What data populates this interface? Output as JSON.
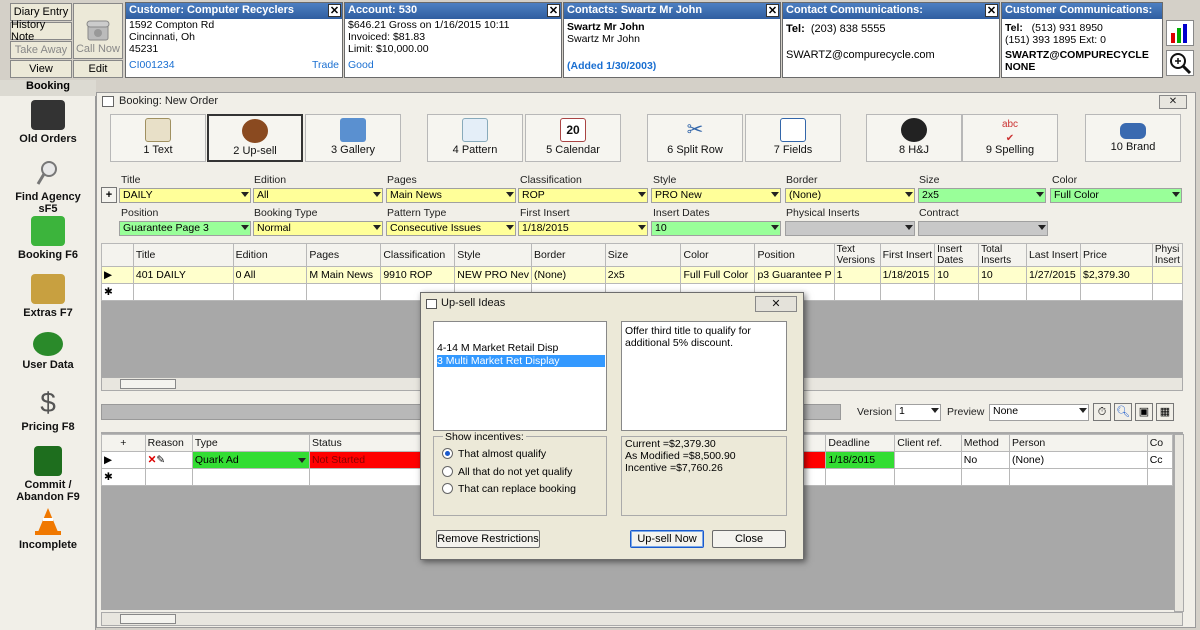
{
  "quick_buttons": {
    "diary": "Diary Entry",
    "history": "History Note",
    "takeaway": "Take Away",
    "view": "View",
    "callnow": "Call Now",
    "edit": "Edit"
  },
  "header": {
    "customer": {
      "title": "Customer: Computer Recyclers",
      "addr1": "1592 Compton Rd",
      "addr2": "Cincinnati, Oh",
      "zip": "45231",
      "id": "CI001234",
      "tag": "Trade"
    },
    "account": {
      "title": "Account: 530",
      "l1": "$646.21 Gross on 1/16/2015 10:11",
      "l2": "Invoiced: $81.83",
      "l3": "Limit: $10,000.00",
      "status": "Good"
    },
    "contacts": {
      "title": "Contacts: Swartz Mr John",
      "name_bold": "Swartz Mr John",
      "name": "Swartz Mr John",
      "added": "(Added 1/30/2003)"
    },
    "contact_comms": {
      "title": "Contact Communications:",
      "tel_label": "Tel:",
      "tel": "(203) 838 5555",
      "email": "SWARTZ@compurecycle.com"
    },
    "customer_comms": {
      "title": "Customer Communications:",
      "tel_label": "Tel:",
      "tel1": "(513) 931 8950",
      "tel2": "(151) 393 1895 Ext: 0",
      "email": "SWARTZ@COMPURECYCLE",
      "none": "NONE"
    }
  },
  "sidebar": {
    "section": "Booking",
    "items": [
      {
        "label": "Old Orders"
      },
      {
        "label": "Find Agency sF5"
      },
      {
        "label": "Booking F6"
      },
      {
        "label": "Extras F7"
      },
      {
        "label": "User Data"
      },
      {
        "label": "Pricing F8"
      },
      {
        "label": "Commit / Abandon F9"
      },
      {
        "label": "Incomplete"
      }
    ]
  },
  "window": {
    "title": "Booking: New Order"
  },
  "toolbar": [
    {
      "label": "1 Text"
    },
    {
      "label": "2 Up-sell"
    },
    {
      "label": "3 Gallery"
    },
    {
      "label": "4 Pattern"
    },
    {
      "label": "5 Calendar"
    },
    {
      "label": "6 Split Row"
    },
    {
      "label": "7 Fields"
    },
    {
      "label": "8 H&J"
    },
    {
      "label": "9 Spelling"
    },
    {
      "label": "10 Brand"
    }
  ],
  "form": {
    "title_label": "Title",
    "title_val": "DAILY",
    "edition_label": "Edition",
    "edition_val": "All",
    "pages_label": "Pages",
    "pages_val": "Main News",
    "class_label": "Classification",
    "class_val": "ROP",
    "style_label": "Style",
    "style_val": "PRO New",
    "border_label": "Border",
    "border_val": "(None)",
    "size_label": "Size",
    "size_val": "2x5",
    "color_label": "Color",
    "color_val": "Full Color",
    "position_label": "Position",
    "position_val": "Guarantee Page 3",
    "booking_type_label": "Booking Type",
    "booking_type_val": "Normal",
    "pattern_label": "Pattern Type",
    "pattern_val": "Consecutive Issues",
    "first_insert_label": "First Insert",
    "first_insert_val": "1/18/2015",
    "insert_dates_label": "Insert Dates",
    "insert_dates_val": "10",
    "physical_label": "Physical Inserts",
    "contract_label": "Contract"
  },
  "grid1": {
    "headers": [
      "Title",
      "Edition",
      "Pages",
      "Classification",
      "Style",
      "Border",
      "Size",
      "Color",
      "Position",
      "Text Versions",
      "First Insert",
      "Insert Dates",
      "Total Inserts",
      "Last Insert",
      "Price",
      "Physi Insert"
    ],
    "row": [
      "401 DAILY",
      "0 All",
      "M Main News",
      "9910 ROP",
      "NEW PRO Nev",
      "(None)",
      "2x5",
      "Full Full Color",
      "p3 Guarantee P",
      "1",
      "1/18/2015",
      "10",
      "10",
      "1/27/2015",
      "$2,379.30",
      ""
    ]
  },
  "version_bar": {
    "version_label": "Version",
    "version_val": "1",
    "preview_label": "Preview",
    "preview_val": "None"
  },
  "grid2": {
    "headers": [
      "Reason",
      "Type",
      "Status",
      "Deadline",
      "Client ref.",
      "Method",
      "Person",
      "Co"
    ],
    "row": {
      "type": "Quark Ad",
      "status": "Not Started",
      "deadline": "1/18/2015",
      "method": "No",
      "person": "(None)",
      "co": "Cc"
    }
  },
  "dialog": {
    "title": "Up-sell Ideas",
    "list": [
      "4-14 M Market Retail Disp",
      "3 Multi Market Ret Display"
    ],
    "selected_index": 1,
    "idea_text": "Offer third title to qualify for additional 5% discount.",
    "current": "Current =$2,379.30",
    "modified": "As Modified =$8,500.90",
    "incentive": "Incentive =$7,760.26",
    "show_incentives": "Show incentives:",
    "radios": [
      "That almost qualify",
      "All that do not yet qualify",
      "That can replace booking"
    ],
    "remove_btn": "Remove Restrictions",
    "upsell_btn": "Up-sell Now",
    "close_btn": "Close"
  },
  "colors": {
    "header_blue": "#3a6ea5",
    "yellow_field": "#ffff99",
    "green_field": "#99ff99",
    "status_red": "#ff0000",
    "select_blue": "#3399ff"
  }
}
